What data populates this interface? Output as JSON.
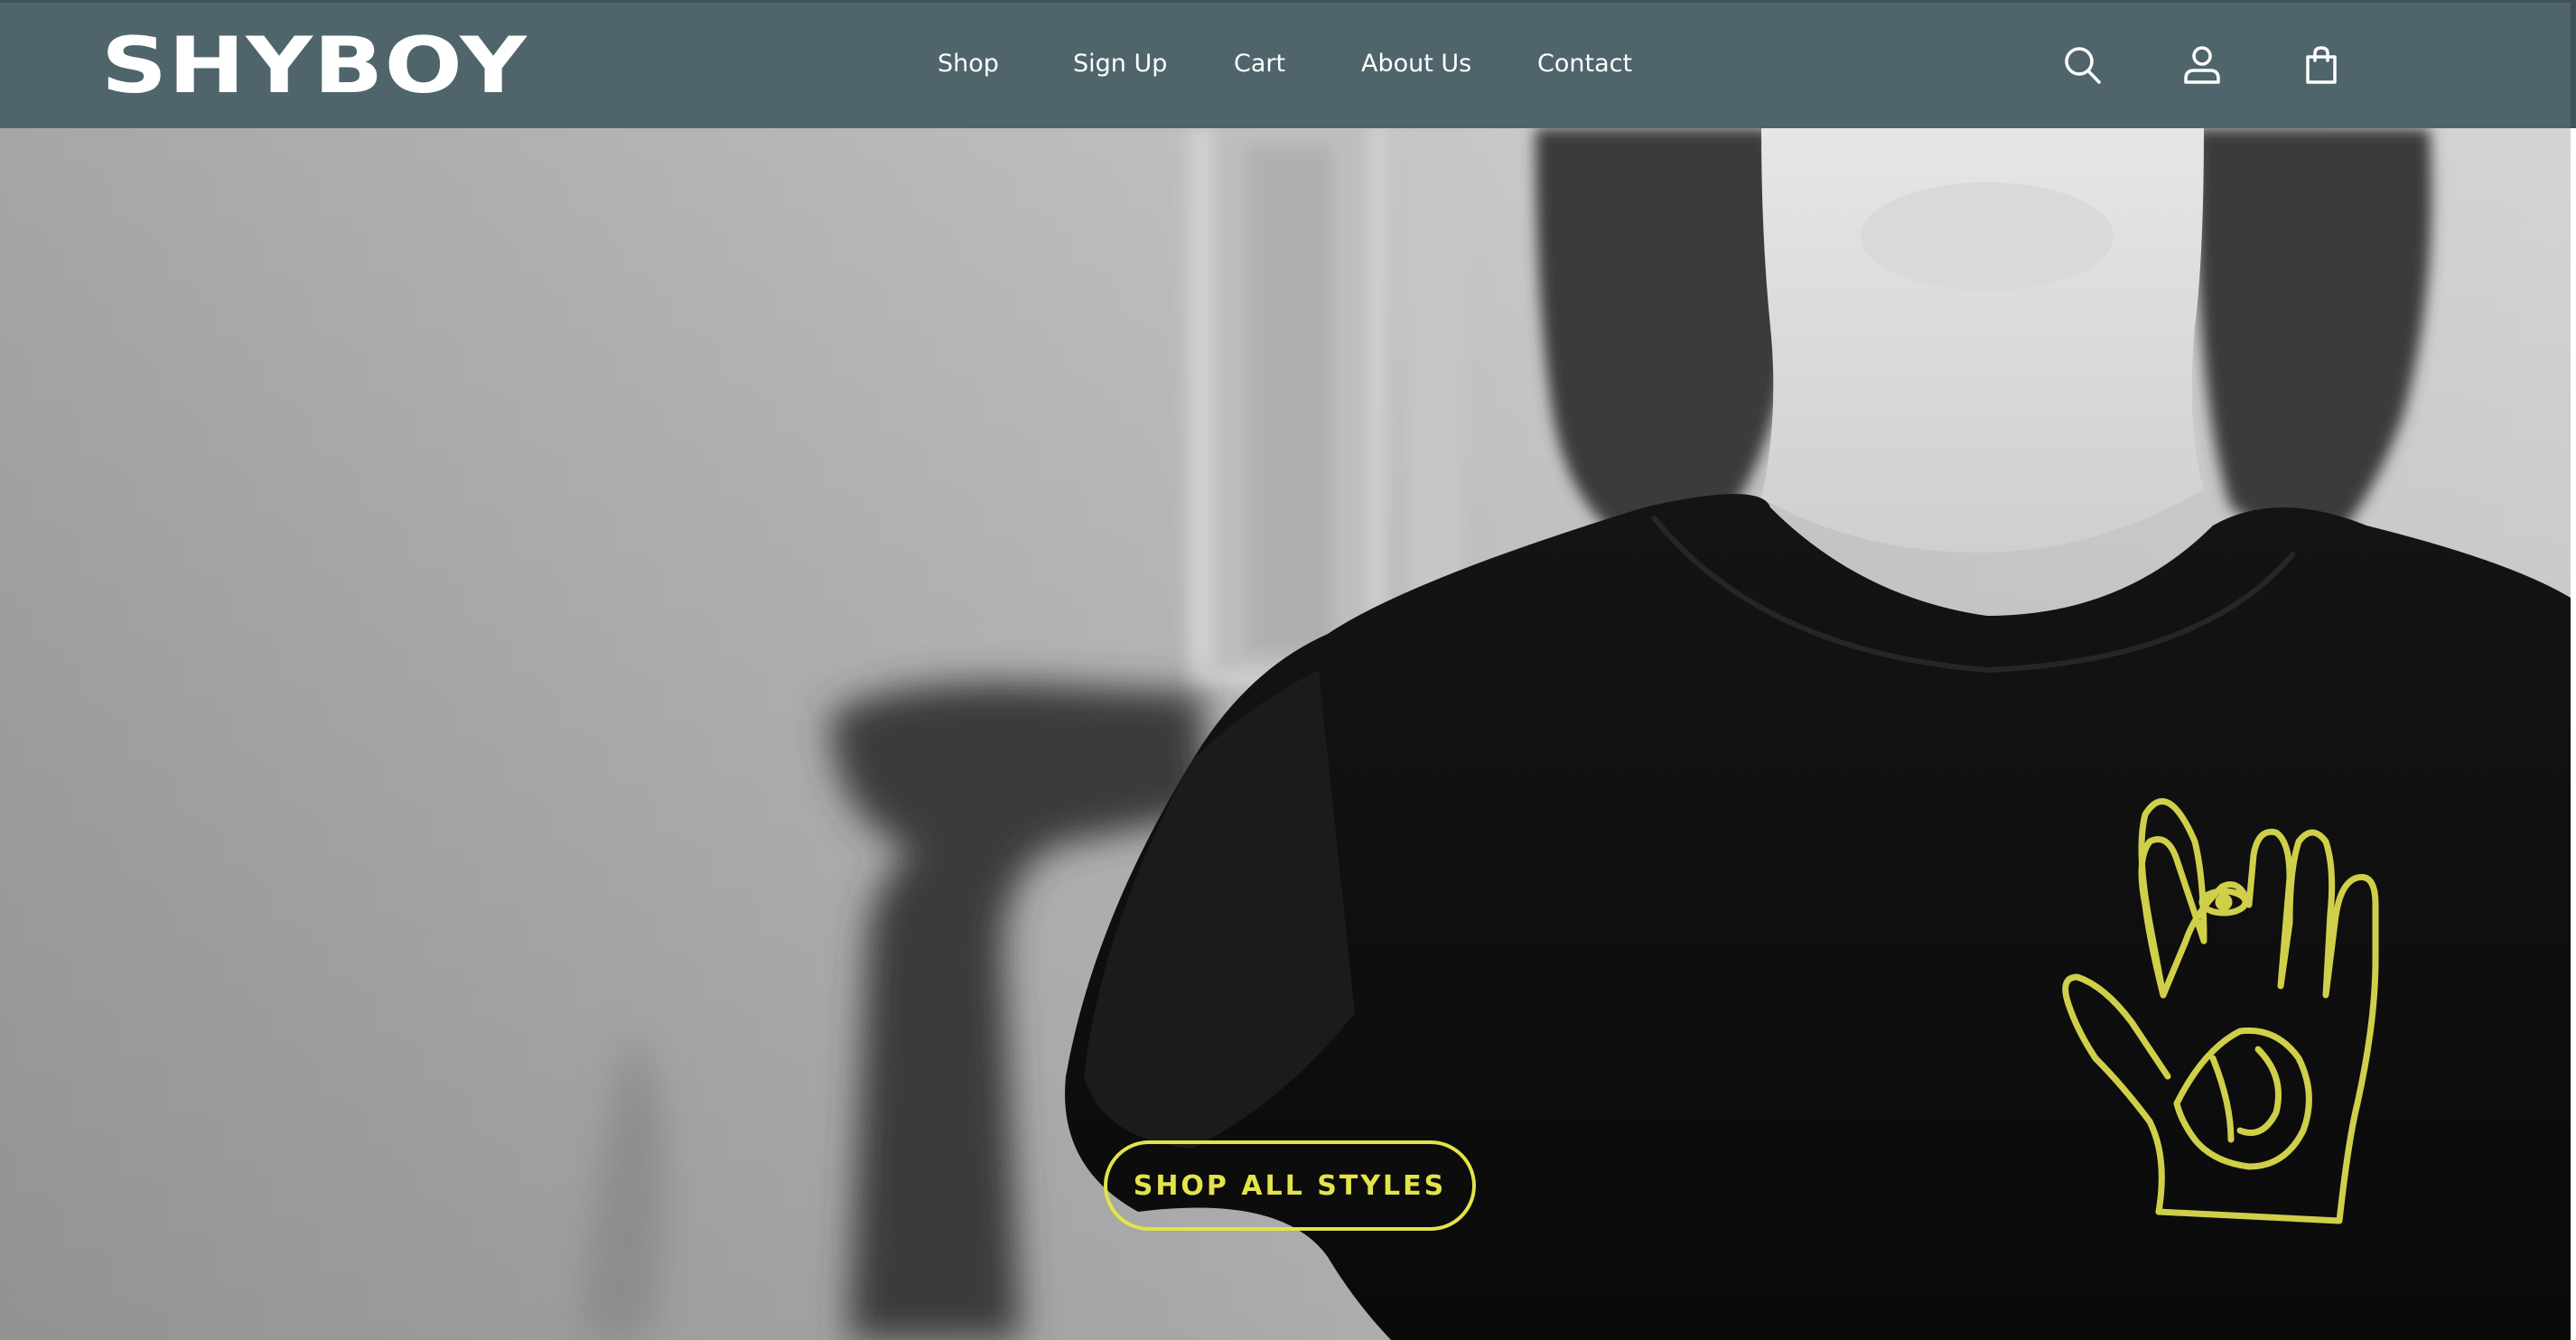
{
  "header": {
    "logo_text": "SHYBOY",
    "background_color": "#4f656b",
    "nav": [
      {
        "label": "Shop"
      },
      {
        "label": "Sign Up"
      },
      {
        "label": "Cart"
      },
      {
        "label": "About Us"
      },
      {
        "label": "Contact"
      }
    ],
    "icons": [
      "search-icon",
      "account-icon",
      "shopping-bag-icon"
    ]
  },
  "hero": {
    "cta_label": "SHOP ALL STYLES",
    "accent_color": "#e3e34a",
    "image_style": "black-and-white photo",
    "tshirt_print": "yellow hand-with-eye line drawing"
  }
}
